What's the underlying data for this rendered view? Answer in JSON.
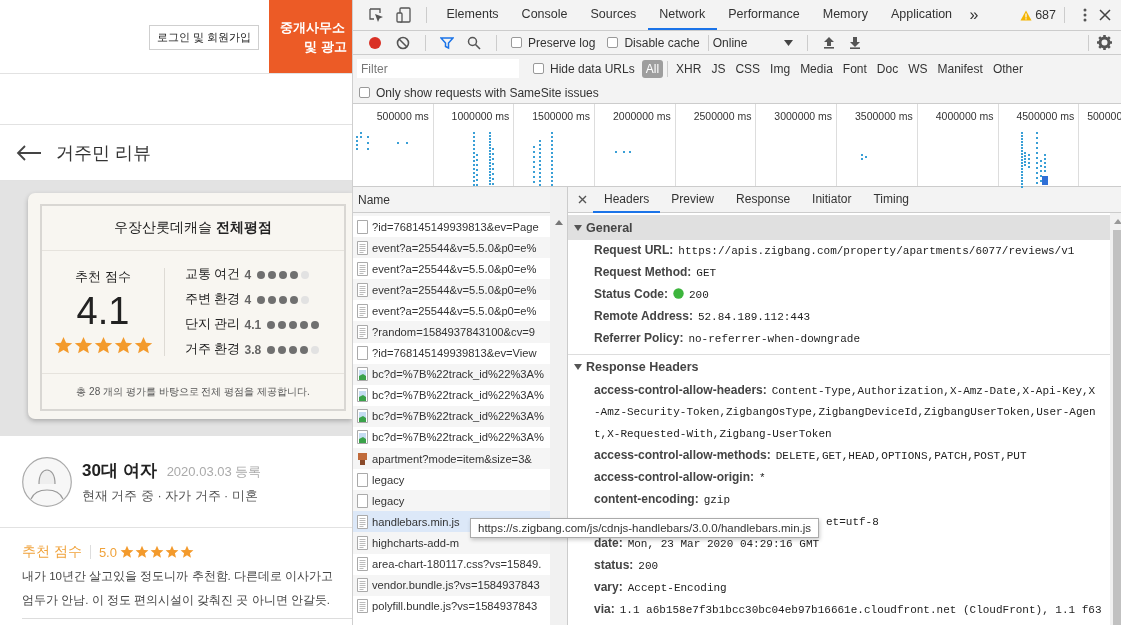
{
  "page": {
    "header": {
      "login_button": "로그인 및 회원가입",
      "banner_lines": [
        "중개사무소",
        "및 광고"
      ]
    },
    "review_header": {
      "title": "거주민 리뷰"
    },
    "summary": {
      "title": "우장산롯데캐슬 **전체평점**",
      "score_label": "추천 점수",
      "score": "4.1",
      "stars": 5,
      "ratings": [
        {
          "label": "교통 여건",
          "value": "4",
          "stars": 4
        },
        {
          "label": "주변 환경",
          "value": "4",
          "stars": 4
        },
        {
          "label": "단지 관리",
          "value": "4.1",
          "stars": 5
        },
        {
          "label": "거주 환경",
          "value": "3.8",
          "stars": 4
        }
      ],
      "note": "총  28 개의 평가를 바탕으로 전체 평점을 제공합니다."
    },
    "review": {
      "author": "30대 여자",
      "date": "2020.03.03 등록",
      "meta": "현재 거주 중 · 자가 거주 · 미혼",
      "score_label": "추천 점수",
      "score": "5.0",
      "stars": 5,
      "text_lines": [
        "내가 10년간 살고있을 정도니까 추천함. 다른데로 이사가고",
        "엄두가 안남. 이 정도 편의시설이 갖춰진 곳 아니면 안갈듯."
      ]
    }
  },
  "devtools": {
    "tabs": [
      {
        "label": "Elements",
        "selected": false
      },
      {
        "label": "Console",
        "selected": false
      },
      {
        "label": "Sources",
        "selected": false
      },
      {
        "label": "Network",
        "selected": true
      },
      {
        "label": "Performance",
        "selected": false
      },
      {
        "label": "Memory",
        "selected": false
      },
      {
        "label": "Application",
        "selected": false
      }
    ],
    "more": "»",
    "warnings": "687",
    "toolbar": {
      "recording": true,
      "preserve_log": {
        "label": "Preserve log",
        "checked": false
      },
      "disable_cache": {
        "label": "Disable cache",
        "checked": false
      },
      "throttling": "Online"
    },
    "filter": {
      "placeholder": "Filter",
      "hide_data_urls": {
        "label": "Hide data URLs",
        "checked": false
      },
      "types": [
        {
          "label": "All",
          "selected": true
        },
        {
          "label": "XHR",
          "selected": false
        },
        {
          "label": "JS",
          "selected": false
        },
        {
          "label": "CSS",
          "selected": false
        },
        {
          "label": "Img",
          "selected": false
        },
        {
          "label": "Media",
          "selected": false
        },
        {
          "label": "Font",
          "selected": false
        },
        {
          "label": "Doc",
          "selected": false
        },
        {
          "label": "WS",
          "selected": false
        },
        {
          "label": "Manifest",
          "selected": false
        },
        {
          "label": "Other",
          "selected": false
        }
      ],
      "samesite": {
        "label": "Only show requests with SameSite issues",
        "checked": false
      }
    },
    "overview": {
      "ticks": [
        "500000 ms",
        "1000000 ms",
        "1500000 ms",
        "2000000 ms",
        "2500000 ms",
        "3000000 ms",
        "3500000 ms",
        "4000000 ms",
        "4500000 ms",
        "500000"
      ]
    },
    "requests": {
      "column": "Name",
      "rows": [
        {
          "name": "?id=768145149939813&ev=Page",
          "kind": "blank",
          "hovered": false
        },
        {
          "name": "event?a=25544&v=5.5.0&p0=e%",
          "kind": "doc",
          "hovered": false
        },
        {
          "name": "event?a=25544&v=5.5.0&p0=e%",
          "kind": "doc",
          "hovered": false
        },
        {
          "name": "event?a=25544&v=5.5.0&p0=e%",
          "kind": "doc",
          "hovered": false
        },
        {
          "name": "event?a=25544&v=5.5.0&p0=e%",
          "kind": "doc",
          "hovered": false
        },
        {
          "name": "?random=1584937843100&cv=9",
          "kind": "doc",
          "hovered": false
        },
        {
          "name": "?id=768145149939813&ev=View",
          "kind": "blank",
          "hovered": false
        },
        {
          "name": "bc?d=%7B%22track_id%22%3A%",
          "kind": "image",
          "hovered": false
        },
        {
          "name": "bc?d=%7B%22track_id%22%3A%",
          "kind": "image",
          "hovered": false
        },
        {
          "name": "bc?d=%7B%22track_id%22%3A%",
          "kind": "image",
          "hovered": false
        },
        {
          "name": "bc?d=%7B%22track_id%22%3A%",
          "kind": "image",
          "hovered": false
        },
        {
          "name": "apartment?mode=item&size=3&",
          "kind": "thumb",
          "hovered": false
        },
        {
          "name": "legacy",
          "kind": "blank",
          "hovered": false
        },
        {
          "name": "legacy",
          "kind": "blank",
          "hovered": false
        },
        {
          "name": "handlebars.min.js",
          "kind": "doc",
          "hovered": true
        },
        {
          "name": "highcharts-add-m",
          "kind": "doc",
          "hovered": false
        },
        {
          "name": "area-chart-180117.css?vs=15849.",
          "kind": "doc",
          "hovered": false
        },
        {
          "name": "vendor.bundle.js?vs=1584937843",
          "kind": "doc",
          "hovered": false
        },
        {
          "name": "polyfill.bundle.js?vs=1584937843",
          "kind": "doc",
          "hovered": false
        }
      ]
    },
    "detail": {
      "tabs": [
        {
          "label": "Headers",
          "selected": true
        },
        {
          "label": "Preview",
          "selected": false
        },
        {
          "label": "Response",
          "selected": false
        },
        {
          "label": "Initiator",
          "selected": false
        },
        {
          "label": "Timing",
          "selected": false
        }
      ],
      "sections": [
        {
          "title": "General",
          "expanded": true,
          "rows": [
            {
              "key": "Request URL:",
              "value": "https://apis.zigbang.com/property/apartments/6077/reviews/v1"
            },
            {
              "key": "Request Method:",
              "value": "GET"
            },
            {
              "key": "Status Code:",
              "value": "200",
              "kind": "status"
            },
            {
              "key": "Remote Address:",
              "value": "52.84.189.112:443"
            },
            {
              "key": "Referrer Policy:",
              "value": "no-referrer-when-downgrade"
            }
          ]
        },
        {
          "title": "Response Headers",
          "expanded": true,
          "rows": [
            {
              "key": "access-control-allow-headers:",
              "value": "Content-Type,Authorization,X-Amz-Date,X-Api-Key,X-Amz-Security-Token,ZigbangOsType,ZigbangDeviceId,ZigbangUserToken,User-Agent,X-Requested-With,Zigbang-UserToken"
            },
            {
              "key": "access-control-allow-methods:",
              "value": "DELETE,GET,HEAD,OPTIONS,PATCH,POST,PUT"
            },
            {
              "key": "access-control-allow-origin:",
              "value": "*"
            },
            {
              "key": "content-encoding:",
              "value": "gzip"
            },
            {
              "value": "et=utf-8",
              "kind": "covered"
            },
            {
              "key": "date:",
              "value": "Mon, 23 Mar 2020 04:29:16 GMT"
            },
            {
              "key": "status:",
              "value": "200"
            },
            {
              "key": "vary:",
              "value": "Accept-Encoding"
            },
            {
              "key": "via:",
              "value": "1.1 a6b158e7f3b1bcc30bc04eb97b16661e.cloudfront.net (CloudFront), 1.1 f63",
              "kind": "nowrap"
            }
          ]
        }
      ]
    },
    "tooltip": "https://s.zigbang.com/js/cdnjs-handlebars/3.0.0/handlebars.min.js"
  }
}
